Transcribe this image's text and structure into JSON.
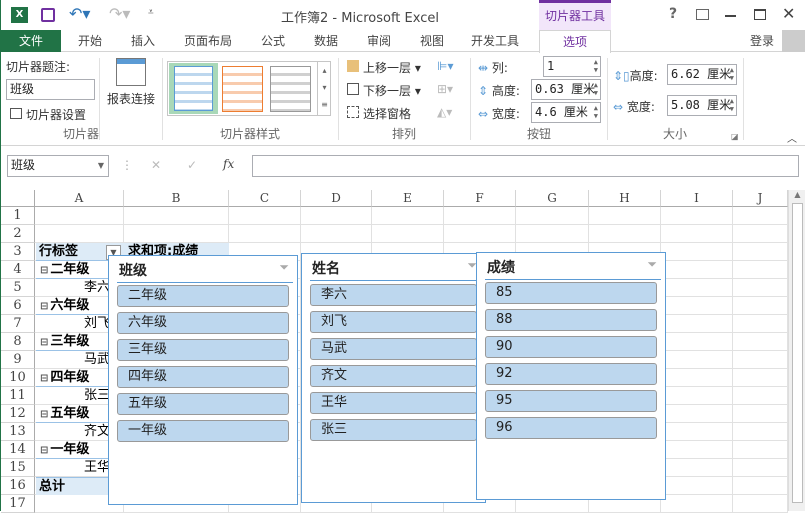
{
  "window": {
    "title": "工作簿2 - Microsoft Excel",
    "context_tab": "切片器工具",
    "help": "?",
    "login": "登录"
  },
  "tabs": [
    "文件",
    "开始",
    "插入",
    "页面布局",
    "公式",
    "数据",
    "审阅",
    "视图",
    "开发工具",
    "选项"
  ],
  "ribbon": {
    "caption_label": "切片器题注:",
    "caption_value": "班级",
    "settings": "切片器设置",
    "report_conn": "报表连接",
    "group_slicer": "切片器",
    "group_styles": "切片器样式",
    "group_arrange": "排列",
    "group_buttons": "按钮",
    "group_size": "大小",
    "bring_forward": "上移一层",
    "send_backward": "下移一层",
    "selection_pane": "选择窗格",
    "columns_label": "列:",
    "columns_value": "1",
    "btn_height_label": "高度:",
    "btn_height_value": "0.63 厘米",
    "btn_width_label": "宽度:",
    "btn_width_value": "4.6 厘米",
    "size_height_label": "高度:",
    "size_height_value": "6.62 厘米",
    "size_width_label": "宽度:",
    "size_width_value": "5.08 厘米"
  },
  "formula_bar": {
    "name_box": "班级",
    "fx": "fx",
    "value": ""
  },
  "columns": [
    "A",
    "B",
    "C",
    "D",
    "E",
    "F",
    "G",
    "H",
    "I",
    "J"
  ],
  "rows": [
    "1",
    "2",
    "3",
    "4",
    "5",
    "6",
    "7",
    "8",
    "9",
    "10",
    "11",
    "12",
    "13",
    "14",
    "15",
    "16",
    "17"
  ],
  "pivot": {
    "row_label": "行标签",
    "sum_label": "求和项:成绩",
    "lines": [
      {
        "t": "二年级",
        "g": true
      },
      {
        "t": "李六"
      },
      {
        "t": "六年级",
        "g": true
      },
      {
        "t": "刘飞"
      },
      {
        "t": "三年级",
        "g": true
      },
      {
        "t": "马武"
      },
      {
        "t": "四年级",
        "g": true
      },
      {
        "t": "张三"
      },
      {
        "t": "五年级",
        "g": true
      },
      {
        "t": "齐文"
      },
      {
        "t": "一年级",
        "g": true
      },
      {
        "t": "王华"
      }
    ],
    "total": "总计"
  },
  "slicers": [
    {
      "title": "班级",
      "items": [
        "二年级",
        "六年级",
        "三年级",
        "四年级",
        "五年级",
        "一年级"
      ]
    },
    {
      "title": "姓名",
      "items": [
        "李六",
        "刘飞",
        "马武",
        "齐文",
        "王华",
        "张三"
      ]
    },
    {
      "title": "成绩",
      "items": [
        "85",
        "88",
        "90",
        "92",
        "95",
        "96"
      ]
    }
  ]
}
